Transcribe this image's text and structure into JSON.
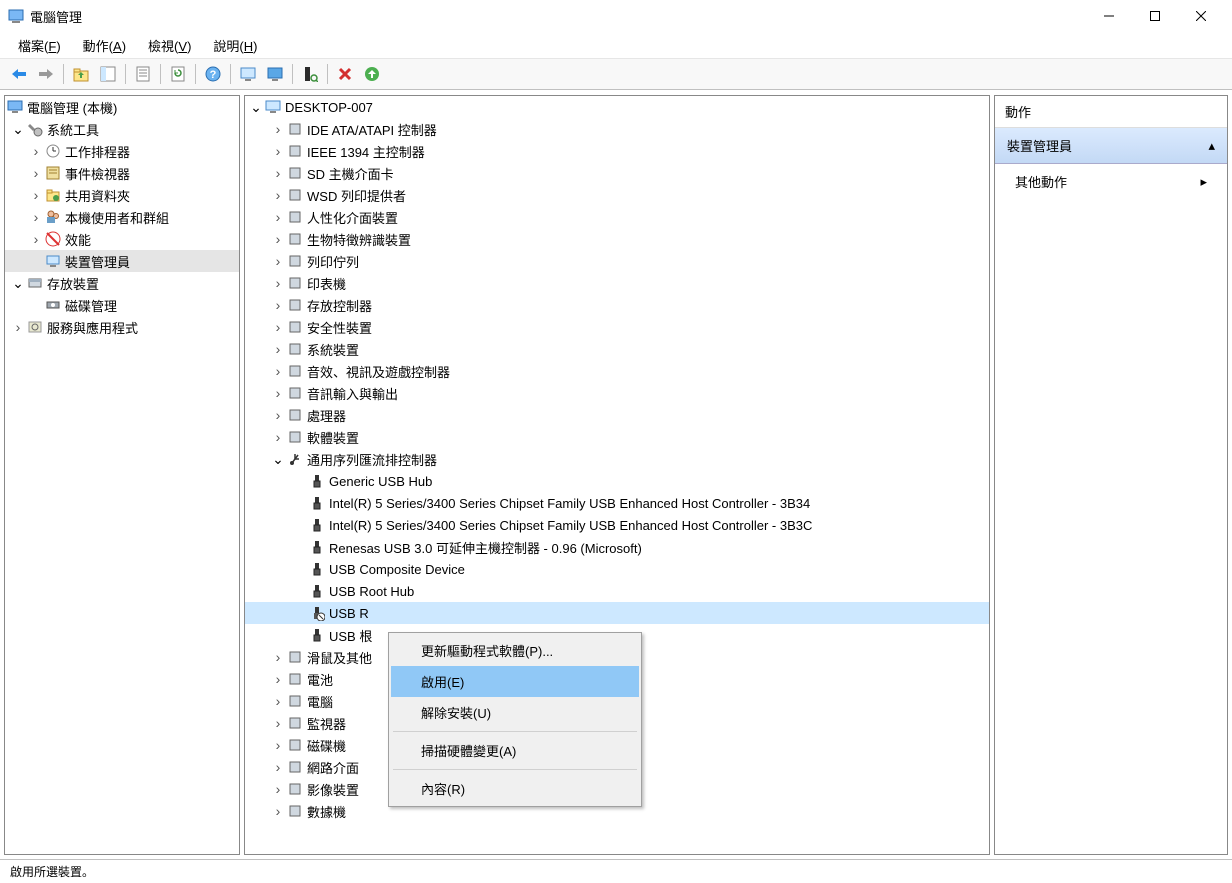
{
  "window": {
    "title": "電腦管理"
  },
  "menubar": [
    {
      "label": "檔案",
      "key": "F"
    },
    {
      "label": "動作",
      "key": "A"
    },
    {
      "label": "檢視",
      "key": "V"
    },
    {
      "label": "說明",
      "key": "H"
    }
  ],
  "toolbar_icons": [
    "back",
    "forward",
    "up",
    "show-hide",
    "export",
    "delete-tb",
    "properties",
    "refresh",
    "help-tb",
    "device-scan",
    "computer-tb",
    "enable-tb",
    "disable-tb",
    "x-red",
    "enable-green"
  ],
  "left_tree": {
    "root": "電腦管理 (本機)",
    "system_tools": {
      "label": "系統工具",
      "children": [
        {
          "label": "工作排程器",
          "icon": "clock"
        },
        {
          "label": "事件檢視器",
          "icon": "event"
        },
        {
          "label": "共用資料夾",
          "icon": "shared"
        },
        {
          "label": "本機使用者和群組",
          "icon": "users"
        },
        {
          "label": "效能",
          "icon": "perf"
        },
        {
          "label": "裝置管理員",
          "icon": "device",
          "selected": true
        }
      ]
    },
    "storage": {
      "label": "存放裝置",
      "children": [
        {
          "label": "磁碟管理",
          "icon": "disk"
        }
      ]
    },
    "services": {
      "label": "服務與應用程式",
      "icon": "services"
    }
  },
  "device_tree": {
    "root": "DESKTOP-007",
    "categories": [
      {
        "label": "IDE ATA/ATAPI 控制器",
        "icon": "ide"
      },
      {
        "label": "IEEE 1394 主控制器",
        "icon": "ieee"
      },
      {
        "label": "SD 主機介面卡",
        "icon": "sd"
      },
      {
        "label": "WSD 列印提供者",
        "icon": "printer"
      },
      {
        "label": "人性化介面裝置",
        "icon": "hid"
      },
      {
        "label": "生物特徵辨識裝置",
        "icon": "bio"
      },
      {
        "label": "列印佇列",
        "icon": "printq"
      },
      {
        "label": "印表機",
        "icon": "printer"
      },
      {
        "label": "存放控制器",
        "icon": "storage"
      },
      {
        "label": "安全性裝置",
        "icon": "security"
      },
      {
        "label": "系統裝置",
        "icon": "system"
      },
      {
        "label": "音效、視訊及遊戲控制器",
        "icon": "audio"
      },
      {
        "label": "音訊輸入與輸出",
        "icon": "audioio"
      },
      {
        "label": "處理器",
        "icon": "cpu"
      },
      {
        "label": "軟體裝置",
        "icon": "software"
      },
      {
        "label": "通用序列匯流排控制器",
        "icon": "usb",
        "expanded": true,
        "children": [
          {
            "label": "Generic USB Hub"
          },
          {
            "label": "Intel(R) 5 Series/3400 Series Chipset Family USB Enhanced Host Controller - 3B34"
          },
          {
            "label": "Intel(R) 5 Series/3400 Series Chipset Family USB Enhanced Host Controller - 3B3C"
          },
          {
            "label": "Renesas USB 3.0 可延伸主機控制器 - 0.96 (Microsoft)"
          },
          {
            "label": "USB Composite Device"
          },
          {
            "label": "USB Root Hub"
          },
          {
            "label": "USB R",
            "truncated": true,
            "selected": true,
            "disabled": true
          },
          {
            "label": "USB 根",
            "truncated": true
          }
        ]
      },
      {
        "label": "滑鼠及其他",
        "truncated": true,
        "icon": "mouse"
      },
      {
        "label": "電池",
        "icon": "battery"
      },
      {
        "label": "電腦",
        "icon": "computer"
      },
      {
        "label": "監視器",
        "icon": "monitor"
      },
      {
        "label": "磁碟機",
        "icon": "diskdrive"
      },
      {
        "label": "網路介面",
        "truncated": true,
        "icon": "network"
      },
      {
        "label": "影像裝置",
        "icon": "imaging"
      },
      {
        "label": "數據機",
        "icon": "modem"
      }
    ]
  },
  "context_menu": [
    {
      "label": "更新驅動程式軟體(P)..."
    },
    {
      "label": "啟用(E)",
      "highlight": true
    },
    {
      "label": "解除安裝(U)"
    },
    {
      "sep": true
    },
    {
      "label": "掃描硬體變更(A)"
    },
    {
      "sep": true
    },
    {
      "label": "內容(R)"
    }
  ],
  "right_panel": {
    "header": "動作",
    "section": "裝置管理員",
    "item": "其他動作"
  },
  "statusbar": "啟用所選裝置。"
}
